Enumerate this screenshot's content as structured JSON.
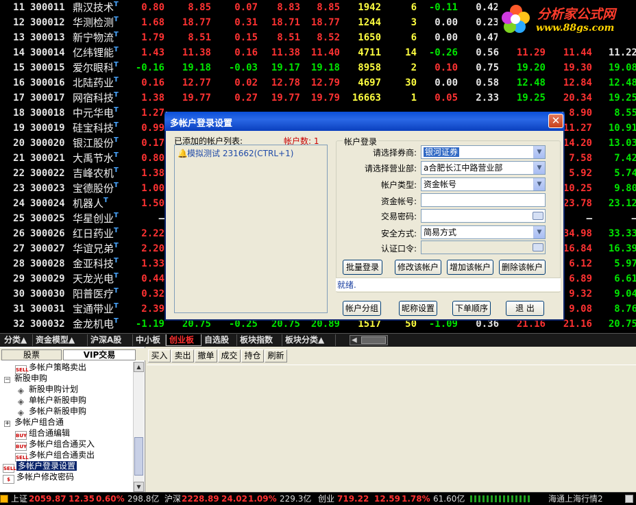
{
  "rows": [
    {
      "idx": "11",
      "code": "300011",
      "name": "鼎汉技术",
      "chg": "0.80",
      "price": "8.85",
      "up": "0.07",
      "bid": "8.83",
      "ask": "8.85",
      "vol": "1942",
      "cur": "6",
      "spd": "-0.11",
      "tr": "0.42",
      "open": "",
      "high": "",
      "low": "",
      "colors": {
        "chg": "red",
        "price": "red",
        "up": "red",
        "bid": "red",
        "ask": "red",
        "spd": "green",
        "open": "red",
        "high": "red",
        "low": "red"
      }
    },
    {
      "idx": "12",
      "code": "300012",
      "name": "华测检测",
      "chg": "1.68",
      "price": "18.77",
      "up": "0.31",
      "bid": "18.71",
      "ask": "18.77",
      "vol": "1244",
      "cur": "3",
      "spd": "0.00",
      "tr": "0.23",
      "open": "",
      "high": "",
      "low": "",
      "colors": {
        "chg": "red",
        "price": "red",
        "up": "red",
        "bid": "red",
        "ask": "red",
        "spd": "white",
        "open": "red",
        "high": "red",
        "low": "red"
      }
    },
    {
      "idx": "13",
      "code": "300013",
      "name": "新宁物流",
      "chg": "1.79",
      "price": "8.51",
      "up": "0.15",
      "bid": "8.51",
      "ask": "8.52",
      "vol": "1650",
      "cur": "6",
      "spd": "0.00",
      "tr": "0.47",
      "open": "",
      "high": "",
      "low": "",
      "colors": {
        "chg": "red",
        "price": "red",
        "up": "red",
        "bid": "red",
        "ask": "red",
        "spd": "white",
        "open": "red",
        "high": "red",
        "low": "red"
      }
    },
    {
      "idx": "14",
      "code": "300014",
      "name": "亿纬锂能",
      "chg": "1.43",
      "price": "11.38",
      "up": "0.16",
      "bid": "11.38",
      "ask": "11.40",
      "vol": "4711",
      "cur": "14",
      "spd": "-0.26",
      "tr": "0.56",
      "open": "11.29",
      "high": "11.44",
      "low": "11.22",
      "colors": {
        "chg": "red",
        "price": "red",
        "up": "red",
        "bid": "red",
        "ask": "red",
        "spd": "green",
        "open": "red",
        "high": "red",
        "low": "white"
      }
    },
    {
      "idx": "15",
      "code": "300015",
      "name": "爱尔眼科",
      "chg": "-0.16",
      "price": "19.18",
      "up": "-0.03",
      "bid": "19.17",
      "ask": "19.18",
      "vol": "8958",
      "cur": "2",
      "spd": "0.10",
      "tr": "0.75",
      "open": "19.20",
      "high": "19.30",
      "low": "19.08",
      "colors": {
        "chg": "green",
        "price": "green",
        "up": "green",
        "bid": "green",
        "ask": "green",
        "spd": "red",
        "open": "green",
        "high": "red",
        "low": "green"
      }
    },
    {
      "idx": "16",
      "code": "300016",
      "name": "北陆药业",
      "chg": "0.16",
      "price": "12.77",
      "up": "0.02",
      "bid": "12.78",
      "ask": "12.79",
      "vol": "4697",
      "cur": "30",
      "spd": "0.00",
      "tr": "0.58",
      "open": "12.48",
      "high": "12.84",
      "low": "12.48",
      "colors": {
        "chg": "red",
        "price": "red",
        "up": "red",
        "bid": "red",
        "ask": "red",
        "spd": "white",
        "open": "green",
        "high": "red",
        "low": "green"
      }
    },
    {
      "idx": "17",
      "code": "300017",
      "name": "网宿科技",
      "chg": "1.38",
      "price": "19.77",
      "up": "0.27",
      "bid": "19.77",
      "ask": "19.79",
      "vol": "16663",
      "cur": "1",
      "spd": "0.05",
      "tr": "2.33",
      "open": "19.25",
      "high": "20.34",
      "low": "19.25",
      "colors": {
        "chg": "red",
        "price": "red",
        "up": "red",
        "bid": "red",
        "ask": "red",
        "spd": "red",
        "open": "green",
        "high": "red",
        "low": "green"
      }
    },
    {
      "idx": "18",
      "code": "300018",
      "name": "中元华电",
      "chg": "1.27",
      "high": "8.90",
      "low": "8.55",
      "colors": {
        "chg": "red",
        "high": "red",
        "low": "green"
      }
    },
    {
      "idx": "19",
      "code": "300019",
      "name": "硅宝科技",
      "chg": "0.99",
      "high": "11.27",
      "low": "10.91",
      "colors": {
        "chg": "red",
        "high": "red",
        "low": "green"
      }
    },
    {
      "idx": "20",
      "code": "300020",
      "name": "银江股份",
      "chg": "0.17",
      "high": "14.20",
      "low": "13.03",
      "colors": {
        "chg": "red",
        "high": "red",
        "low": "green"
      }
    },
    {
      "idx": "21",
      "code": "300021",
      "name": "大禹节水",
      "chg": "0.80",
      "high": "7.58",
      "low": "7.42",
      "colors": {
        "chg": "red",
        "high": "red",
        "low": "green"
      }
    },
    {
      "idx": "22",
      "code": "300022",
      "name": "吉峰农机",
      "chg": "1.38",
      "high": "5.92",
      "low": "5.74",
      "colors": {
        "chg": "red",
        "high": "red",
        "low": "green"
      }
    },
    {
      "idx": "23",
      "code": "300023",
      "name": "宝德股份",
      "chg": "1.00",
      "high": "10.25",
      "low": "9.80",
      "colors": {
        "chg": "red",
        "high": "red",
        "low": "green"
      }
    },
    {
      "idx": "24",
      "code": "300024",
      "name": "机器人",
      "chg": "1.50",
      "high": "23.78",
      "low": "23.12",
      "colors": {
        "chg": "red",
        "high": "red",
        "low": "green"
      }
    },
    {
      "idx": "25",
      "code": "300025",
      "name": "华星创业",
      "chg": "–",
      "high": "–",
      "low": "–",
      "colors": {
        "chg": "white",
        "high": "white",
        "low": "white"
      }
    },
    {
      "idx": "26",
      "code": "300026",
      "name": "红日药业",
      "chg": "2.22",
      "high": "34.98",
      "low": "33.33",
      "colors": {
        "chg": "red",
        "high": "red",
        "low": "green"
      }
    },
    {
      "idx": "27",
      "code": "300027",
      "name": "华谊兄弟",
      "chg": "2.20",
      "high": "16.84",
      "low": "16.39",
      "colors": {
        "chg": "red",
        "high": "red",
        "low": "green"
      }
    },
    {
      "idx": "28",
      "code": "300028",
      "name": "金亚科技",
      "chg": "1.33",
      "high": "6.12",
      "low": "5.97",
      "colors": {
        "chg": "red",
        "high": "red",
        "low": "green"
      }
    },
    {
      "idx": "29",
      "code": "300029",
      "name": "天龙光电",
      "chg": "0.44",
      "high": "6.89",
      "low": "6.61",
      "colors": {
        "chg": "red",
        "high": "red",
        "low": "green"
      }
    },
    {
      "idx": "30",
      "code": "300030",
      "name": "阳普医疗",
      "chg": "0.32",
      "high": "9.32",
      "low": "9.04",
      "colors": {
        "chg": "red",
        "high": "red",
        "low": "green"
      }
    },
    {
      "idx": "31",
      "code": "300031",
      "name": "宝通带业",
      "chg": "2.39",
      "high": "9.08",
      "low": "8.76",
      "colors": {
        "chg": "red",
        "high": "red",
        "low": "green"
      }
    },
    {
      "idx": "32",
      "code": "300032",
      "name": "金龙机电",
      "chg": "-1.19",
      "price": "20.75",
      "up": "-0.25",
      "bid": "20.75",
      "ask": "20.89",
      "vol": "1517",
      "cur": "50",
      "spd": "-1.09",
      "tr": "0.36",
      "open": "21.16",
      "high": "21.16",
      "low": "20.75",
      "colors": {
        "chg": "green",
        "price": "green",
        "up": "green",
        "bid": "green",
        "ask": "green",
        "spd": "green",
        "open": "red",
        "high": "red",
        "low": "green"
      }
    }
  ],
  "logo": {
    "brand": "分析家公式网",
    "url": "www.88gs.com"
  },
  "dialog": {
    "title": "多帐户登录设置",
    "close": "✕",
    "list_label": "已添加的帐户列表:",
    "count_label": "帐户数: 1",
    "account_item": "模拟测试 231662(CTRL+1)",
    "group_label": "帐户登录",
    "broker_label": "请选择券商:",
    "broker_value": "银河证券",
    "branch_label": "请选择营业部:",
    "branch_value": "a合肥长江中路营业部",
    "type_label": "帐户类型:",
    "type_value": "资金帐号",
    "fund_label": "资金帐号:",
    "password_label": "交易密码:",
    "security_label": "安全方式:",
    "security_value": "简易方式",
    "auth_label": "认证口令:",
    "btn_batch": "批量登录",
    "btn_modify": "修改该帐户",
    "btn_add": "增加该帐户",
    "btn_delete": "删除该帐户",
    "status": "就绪.",
    "btn_group": "帐户分组",
    "btn_nick": "昵称设置",
    "btn_order": "下单顺序",
    "btn_exit": "退 出"
  },
  "tabs": [
    "分类▲",
    "资金模型▲",
    "沪深A股",
    "中小板",
    "创业板",
    "自选股",
    "板块指数",
    "板块分类▲"
  ],
  "active_tab": "创业板",
  "left_panel": {
    "tab_stock": "股票",
    "tab_vip": "VIP交易",
    "tree": [
      {
        "label": "多帐户策略卖出",
        "icon": "SELL",
        "indent": 22
      },
      {
        "label": "新股申购",
        "icon": "−",
        "indent": 6,
        "expander": true
      },
      {
        "label": "新股申购计划",
        "icon": "◈",
        "indent": 22
      },
      {
        "label": "单帐户新股申购",
        "icon": "◈",
        "indent": 22
      },
      {
        "label": "多帐户新股申购",
        "icon": "◈",
        "indent": 22
      },
      {
        "label": "多帐户组合通",
        "icon": "+",
        "indent": 6,
        "expander": true
      },
      {
        "label": "组合通编辑",
        "icon": "BUY",
        "indent": 22
      },
      {
        "label": "多帐户组合通买入",
        "icon": "BUY",
        "indent": 22
      },
      {
        "label": "多帐户组合通卖出",
        "icon": "SELL",
        "indent": 22
      },
      {
        "label": "多帐户登录设置",
        "icon": "SELL",
        "indent": 4,
        "selected": true
      },
      {
        "label": "多帐户修改密码",
        "icon": "$",
        "indent": 4
      }
    ]
  },
  "trade_toolbar": [
    "买入",
    "卖出",
    "撤单",
    "成交",
    "持仓",
    "刷新"
  ],
  "status": {
    "sh_label": "上证",
    "sh_val": "2059.87",
    "sh_chg": "12.35",
    "sh_pct": "0.60%",
    "sh_amt": "298.8亿",
    "hs_label": "沪深",
    "hs_val": "2228.89",
    "hs_chg": "24.02",
    "hs_pct": "1.09%",
    "hs_amt": "229.3亿",
    "cy_label": "创业",
    "cy_val": "719.22",
    "cy_chg": "12.59",
    "cy_pct": "1.78%",
    "cy_amt": "61.60亿",
    "server": "海通上海行情2"
  },
  "colors": {
    "up": "#ff3232",
    "down": "#00e600",
    "volume": "#ffff40",
    "title_blue": "#0b4fd8"
  }
}
